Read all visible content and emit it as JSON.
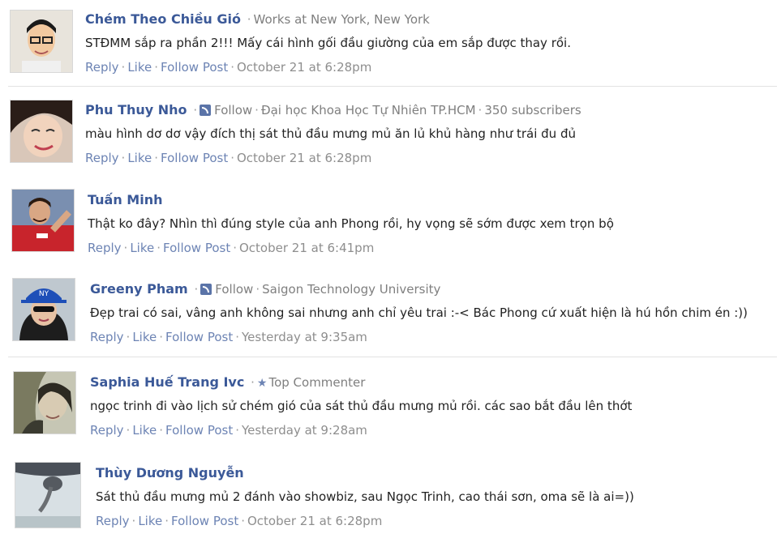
{
  "comments": [
    {
      "name": "Chém Theo Chiều Gió",
      "meta": "Works at New York, New York",
      "text": "STĐMM sắp ra phần 2!!! Mấy cái hình gối đầu giường của em sắp được thay rồi.",
      "reply": "Reply",
      "like": "Like",
      "follow_post": "Follow Post",
      "time": "October 21 at 6:28pm"
    },
    {
      "name": "Phu Thuy Nho",
      "follow": "Follow",
      "meta": "Đại học Khoa Học Tự Nhiên TP.HCM",
      "subscribers": "350 subscribers",
      "text": "màu hình dơ dơ vậy đích thị sát thủ đầu mưng mủ ăn lủ khủ hàng như trái đu đủ",
      "reply": "Reply",
      "like": "Like",
      "follow_post": "Follow Post",
      "time": "October 21 at 6:28pm"
    },
    {
      "name": "Tuấn Minh",
      "text": "Thật ko đây? Nhìn thì đúng style của anh Phong rồi, hy vọng sẽ sớm được xem trọn bộ",
      "reply": "Reply",
      "like": "Like",
      "follow_post": "Follow Post",
      "time": "October 21 at 6:41pm"
    },
    {
      "name": "Greeny Pham",
      "follow": "Follow",
      "meta": "Saigon Technology University",
      "text": "Đẹp trai có sai, vâng anh không sai nhưng anh chỉ yêu trai :-< Bác Phong cứ xuất hiện là hú hồn chim én :))",
      "reply": "Reply",
      "like": "Like",
      "follow_post": "Follow Post",
      "time": "Yesterday at 9:35am"
    },
    {
      "name": "Saphia Huế Trang Ivc",
      "badge": "Top Commenter",
      "text": "ngọc trinh đi vào lịch sử chém gió của sát thủ đầu mưng mủ rồi. các sao bắt đầu lên thớt",
      "reply": "Reply",
      "like": "Like",
      "follow_post": "Follow Post",
      "time": "Yesterday at 9:28am"
    },
    {
      "name": "Thùy Dương Nguyễn",
      "text": "Sát thủ đầu mưng mủ 2 đánh vào showbiz, sau Ngọc Trinh, cao thái sơn, oma sẽ là ai=))",
      "reply": "Reply",
      "like": "Like",
      "follow_post": "Follow Post",
      "time": "October 21 at 6:28pm"
    }
  ]
}
